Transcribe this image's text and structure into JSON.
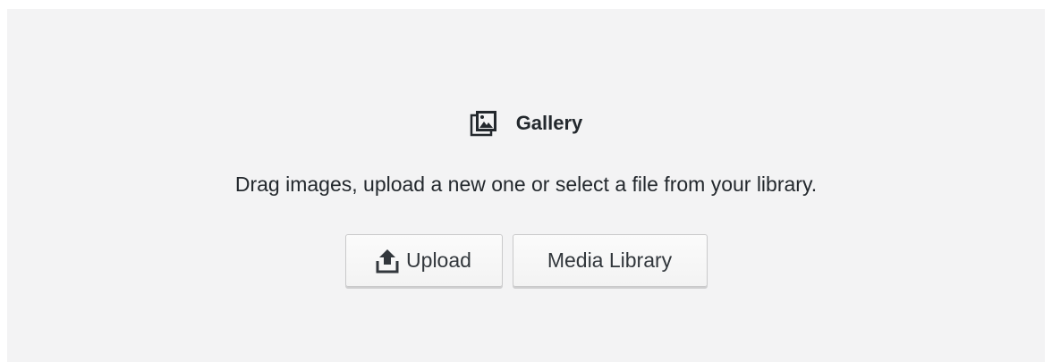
{
  "block": {
    "icon": "gallery-icon",
    "title": "Gallery",
    "instructions": "Drag images, upload a new one or select a file from your library."
  },
  "actions": {
    "upload_icon": "upload-icon",
    "upload_label": "Upload",
    "media_library_label": "Media Library"
  },
  "colors": {
    "background": "#f3f3f4",
    "text": "#23282d",
    "button_border": "#c9c9ca"
  }
}
